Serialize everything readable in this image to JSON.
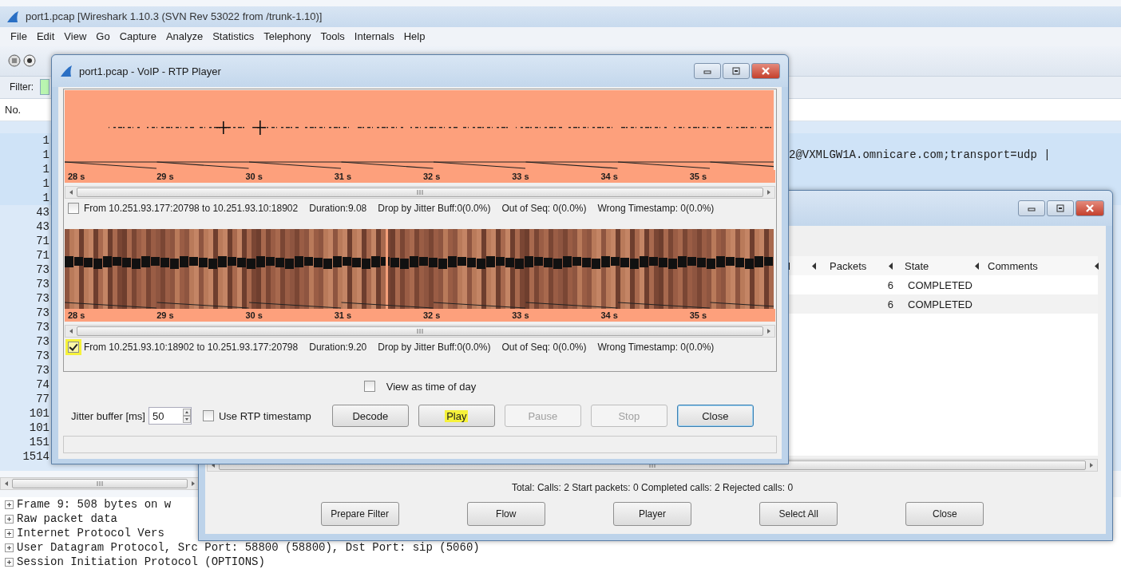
{
  "main_window": {
    "title": "port1.pcap  [Wireshark 1.10.3  (SVN Rev 53022 from /trunk-1.10)]"
  },
  "menu": [
    "File",
    "Edit",
    "View",
    "Go",
    "Capture",
    "Analyze",
    "Statistics",
    "Telephony",
    "Tools",
    "Internals",
    "Help"
  ],
  "filter": {
    "label": "Filter:"
  },
  "packet_list": {
    "columns": [
      "No."
    ],
    "rows": [
      {
        "no": "1"
      },
      {
        "no": "1",
        "info": "2@VXMLGW1A.omnicare.com;transport=udp |"
      },
      {
        "no": "1"
      },
      {
        "no": "1"
      },
      {
        "no": "1"
      },
      {
        "no": "43"
      },
      {
        "no": "43"
      },
      {
        "no": "71"
      },
      {
        "no": "71"
      },
      {
        "no": "73"
      },
      {
        "no": "73"
      },
      {
        "no": "73"
      },
      {
        "no": "73"
      },
      {
        "no": "73"
      },
      {
        "no": "73"
      },
      {
        "no": "73"
      },
      {
        "no": "73"
      },
      {
        "no": "74"
      },
      {
        "no": "77"
      },
      {
        "no": "101"
      },
      {
        "no": "101"
      },
      {
        "no": "151"
      },
      {
        "no": "1514"
      }
    ]
  },
  "packet_details": [
    "Frame 9: 508 bytes on w",
    "Raw packet data",
    "Internet Protocol Vers",
    "User Datagram Protocol, Src Port: 58800 (58800), Dst Port: sip (5060)",
    "Session Initiation Protocol (OPTIONS)"
  ],
  "voip_calls": {
    "columns": [
      "l",
      "Packets",
      "State",
      "Comments"
    ],
    "rows": [
      {
        "packets": "6",
        "state": "COMPLETED"
      },
      {
        "packets": "6",
        "state": "COMPLETED"
      }
    ],
    "summary": "Total: Calls: 2  Start packets: 0  Completed calls: 2  Rejected calls: 0",
    "buttons": [
      "Prepare Filter",
      "Flow",
      "Player",
      "Select All",
      "Close"
    ]
  },
  "rtp_player": {
    "title": "port1.pcap - VoIP - RTP Player",
    "streams": [
      {
        "kind": "sparse",
        "time_labels": [
          "28 s",
          "29 s",
          "30 s",
          "31 s",
          "32 s",
          "33 s",
          "34 s",
          "35 s"
        ],
        "checked": false,
        "highlighted": false,
        "label": "From 10.251.93.177:20798 to 10.251.93.10:18902",
        "stats": [
          "Duration:9.08",
          "Drop by Jitter Buff:0(0.0%)",
          "Out of Seq: 0(0.0%)",
          "Wrong Timestamp: 0(0.0%)"
        ]
      },
      {
        "kind": "dense",
        "time_labels": [
          "28 s",
          "29 s",
          "30 s",
          "31 s",
          "32 s",
          "33 s",
          "34 s",
          "35 s"
        ],
        "checked": true,
        "highlighted": true,
        "label": "From 10.251.93.10:18902 to 10.251.93.177:20798",
        "stats": [
          "Duration:9.20",
          "Drop by Jitter Buff:0(0.0%)",
          "Out of Seq: 0(0.0%)",
          "Wrong Timestamp: 0(0.0%)"
        ]
      }
    ],
    "view_time_of_day": {
      "label": "View as time of day",
      "checked": false
    },
    "jitter": {
      "label": "Jitter buffer [ms]",
      "value": "50"
    },
    "use_rtp_timestamp": {
      "label": "Use RTP timestamp",
      "checked": false
    },
    "buttons": [
      {
        "label": "Decode",
        "disabled": false,
        "highlighted": false,
        "default": false
      },
      {
        "label": "Play",
        "disabled": false,
        "highlighted": true,
        "default": false
      },
      {
        "label": "Pause",
        "disabled": true,
        "highlighted": false,
        "default": false
      },
      {
        "label": "Stop",
        "disabled": true,
        "highlighted": false,
        "default": false
      },
      {
        "label": "Close",
        "disabled": false,
        "highlighted": false,
        "default": true
      }
    ]
  }
}
